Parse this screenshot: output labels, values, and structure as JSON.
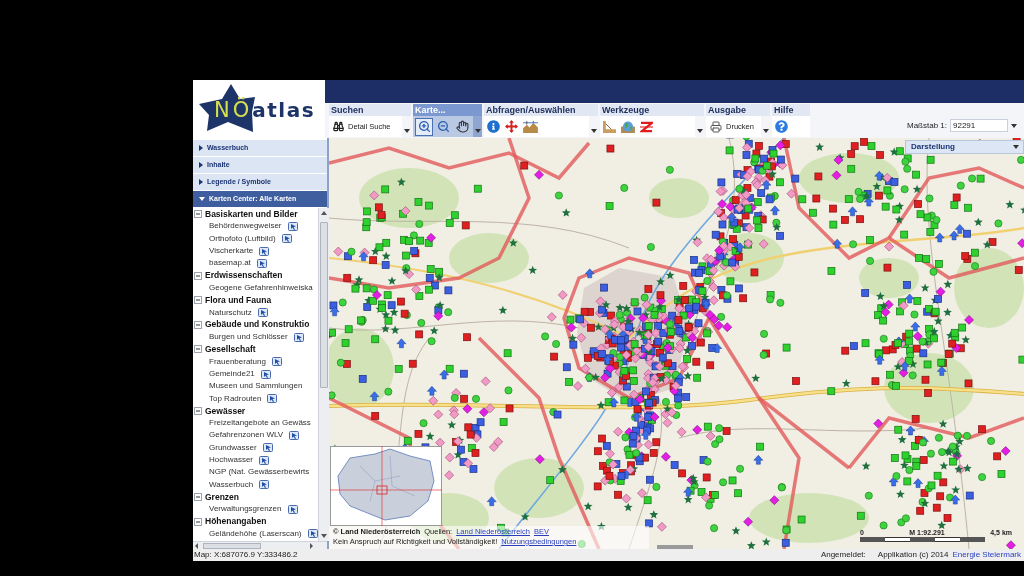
{
  "logo": {
    "part_1": "NÖ",
    "part_2": "atlas"
  },
  "toolbar": [
    {
      "label": "Suchen",
      "selected": false,
      "dropdown": true,
      "button": "Detail Suche"
    },
    {
      "label": "Karte...",
      "selected": true,
      "dropdown": true,
      "tools": [
        {
          "selected": true
        },
        {
          "selected": false
        },
        {
          "selected": false
        }
      ]
    },
    {
      "label": "Abfragen/Auswählen",
      "selected": false,
      "dropdown": true
    },
    {
      "label": "Werkzeuge",
      "selected": false,
      "dropdown": true
    },
    {
      "label": "Ausgabe",
      "selected": false,
      "dropdown": true,
      "button": "Drucken"
    },
    {
      "label": "Hilfe",
      "selected": false,
      "dropdown": false
    }
  ],
  "scale": {
    "label": "Maßstab 1:",
    "value": "92291"
  },
  "sidebar": {
    "panels": [
      {
        "title": "Wasserbuch",
        "expanded": false
      },
      {
        "title": "Inhalte",
        "expanded": false
      },
      {
        "title": "Legende / Symbole",
        "expanded": false
      },
      {
        "title": "Karten Center: Alle Karten",
        "expanded": true
      }
    ],
    "tree": [
      {
        "label": "Basiskarten und Bilder",
        "expanded": true,
        "children": [
          {
            "label": "Behördenwegweiser",
            "info_icon": true
          },
          {
            "label": "Orthofoto (Luftbild)",
            "info_icon": true
          },
          {
            "label": "Vischerkarte",
            "info_icon": true
          },
          {
            "label": "basemap.at",
            "info_icon": true
          }
        ]
      },
      {
        "label": "Erdwissenschaften",
        "expanded": true,
        "children": [
          {
            "label": "Geogene Gefahrenhinweiska",
            "info_icon": false
          }
        ]
      },
      {
        "label": "Flora und Fauna",
        "expanded": true,
        "children": [
          {
            "label": "Naturschutz",
            "info_icon": true
          }
        ]
      },
      {
        "label": "Gebäude und Konstruktio",
        "expanded": true,
        "children": [
          {
            "label": "Burgen und Schlösser",
            "info_icon": true
          }
        ]
      },
      {
        "label": "Gesellschaft",
        "expanded": true,
        "children": [
          {
            "label": "Frauenberatung",
            "info_icon": true
          },
          {
            "label": "Gemeinde21",
            "info_icon": true
          },
          {
            "label": "Museen und Sammlungen",
            "info_icon": false
          },
          {
            "label": "Top Radrouten",
            "info_icon": true
          }
        ]
      },
      {
        "label": "Gewässer",
        "expanded": true,
        "children": [
          {
            "label": "Freizeitangebote an Gewäss",
            "info_icon": false
          },
          {
            "label": "Gefahrenzonen WLV",
            "info_icon": true
          },
          {
            "label": "Grundwasser",
            "info_icon": true
          },
          {
            "label": "Hochwasser",
            "info_icon": true
          },
          {
            "label": "NGP (Nat. Gewässerbewirts",
            "info_icon": false
          },
          {
            "label": "Wasserbuch",
            "info_icon": true
          }
        ]
      },
      {
        "label": "Grenzen",
        "expanded": true,
        "children": [
          {
            "label": "Verwaltungsgrenzen",
            "info_icon": true
          }
        ]
      },
      {
        "label": "Höhenangaben",
        "expanded": true,
        "children": [
          {
            "label": "Geländehöhe (Laserscan)",
            "info_icon": true
          }
        ]
      }
    ]
  },
  "map": {
    "display_panel": {
      "title": "Darstellung"
    },
    "attribution": {
      "copyright": "© Land Niederösterreich",
      "sources_label": "Quellen:",
      "sources": [
        "Land Niederösterreich",
        "BEV"
      ],
      "disclaimer": "Kein Anspruch auf Richtigkeit und Vollständigkeit!",
      "terms_link": "Nutzungsbedingungen"
    },
    "scale_bar": {
      "start": "0",
      "ratio": "M 1:92.291",
      "end": "4,5 km"
    }
  },
  "status_bar": {
    "coordinates": "Map: X:687076.9 Y:333486.2",
    "login": "Angemeldet:",
    "copyright": "Applikation (c) 2014",
    "link": "Energie Steiermark"
  }
}
